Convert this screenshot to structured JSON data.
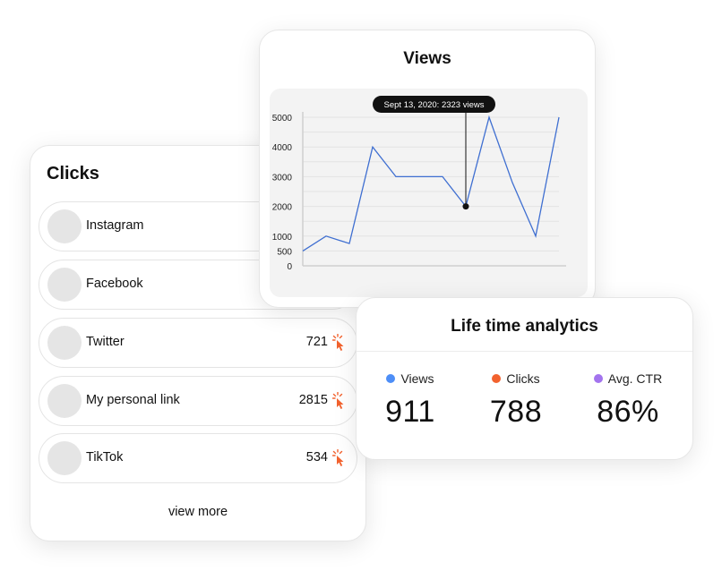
{
  "clicks": {
    "title": "Clicks",
    "rows": [
      {
        "label": "Instagram",
        "count": ""
      },
      {
        "label": "Facebook",
        "count": ""
      },
      {
        "label": "Twitter",
        "count": "721"
      },
      {
        "label": "My personal link",
        "count": "2815"
      },
      {
        "label": "TikTok",
        "count": "534"
      }
    ],
    "view_more": "view more",
    "click_icon": "pointer-click-icon",
    "icon_color": "#f2622e"
  },
  "views": {
    "title": "Views",
    "tooltip": "Sept 13, 2020: 2323 views"
  },
  "chart_data": {
    "type": "line",
    "title": "Views",
    "ylim": [
      0,
      5000
    ],
    "yticks": [
      0,
      500,
      1000,
      2000,
      3000,
      4000,
      5000
    ],
    "values": [
      500,
      1000,
      750,
      4000,
      3000,
      3000,
      3000,
      2000,
      5000,
      2800,
      1000,
      5000
    ],
    "highlight_index": 7,
    "line_color": "#3f6fd1",
    "grid": true
  },
  "analytics": {
    "title": "Life time analytics",
    "stats": [
      {
        "label": "Views",
        "value": "911",
        "color": "#4d8ef7"
      },
      {
        "label": "Clicks",
        "value": "788",
        "color": "#f2622e"
      },
      {
        "label": "Avg. CTR",
        "value": "86%",
        "color": "#a374ee"
      }
    ]
  }
}
